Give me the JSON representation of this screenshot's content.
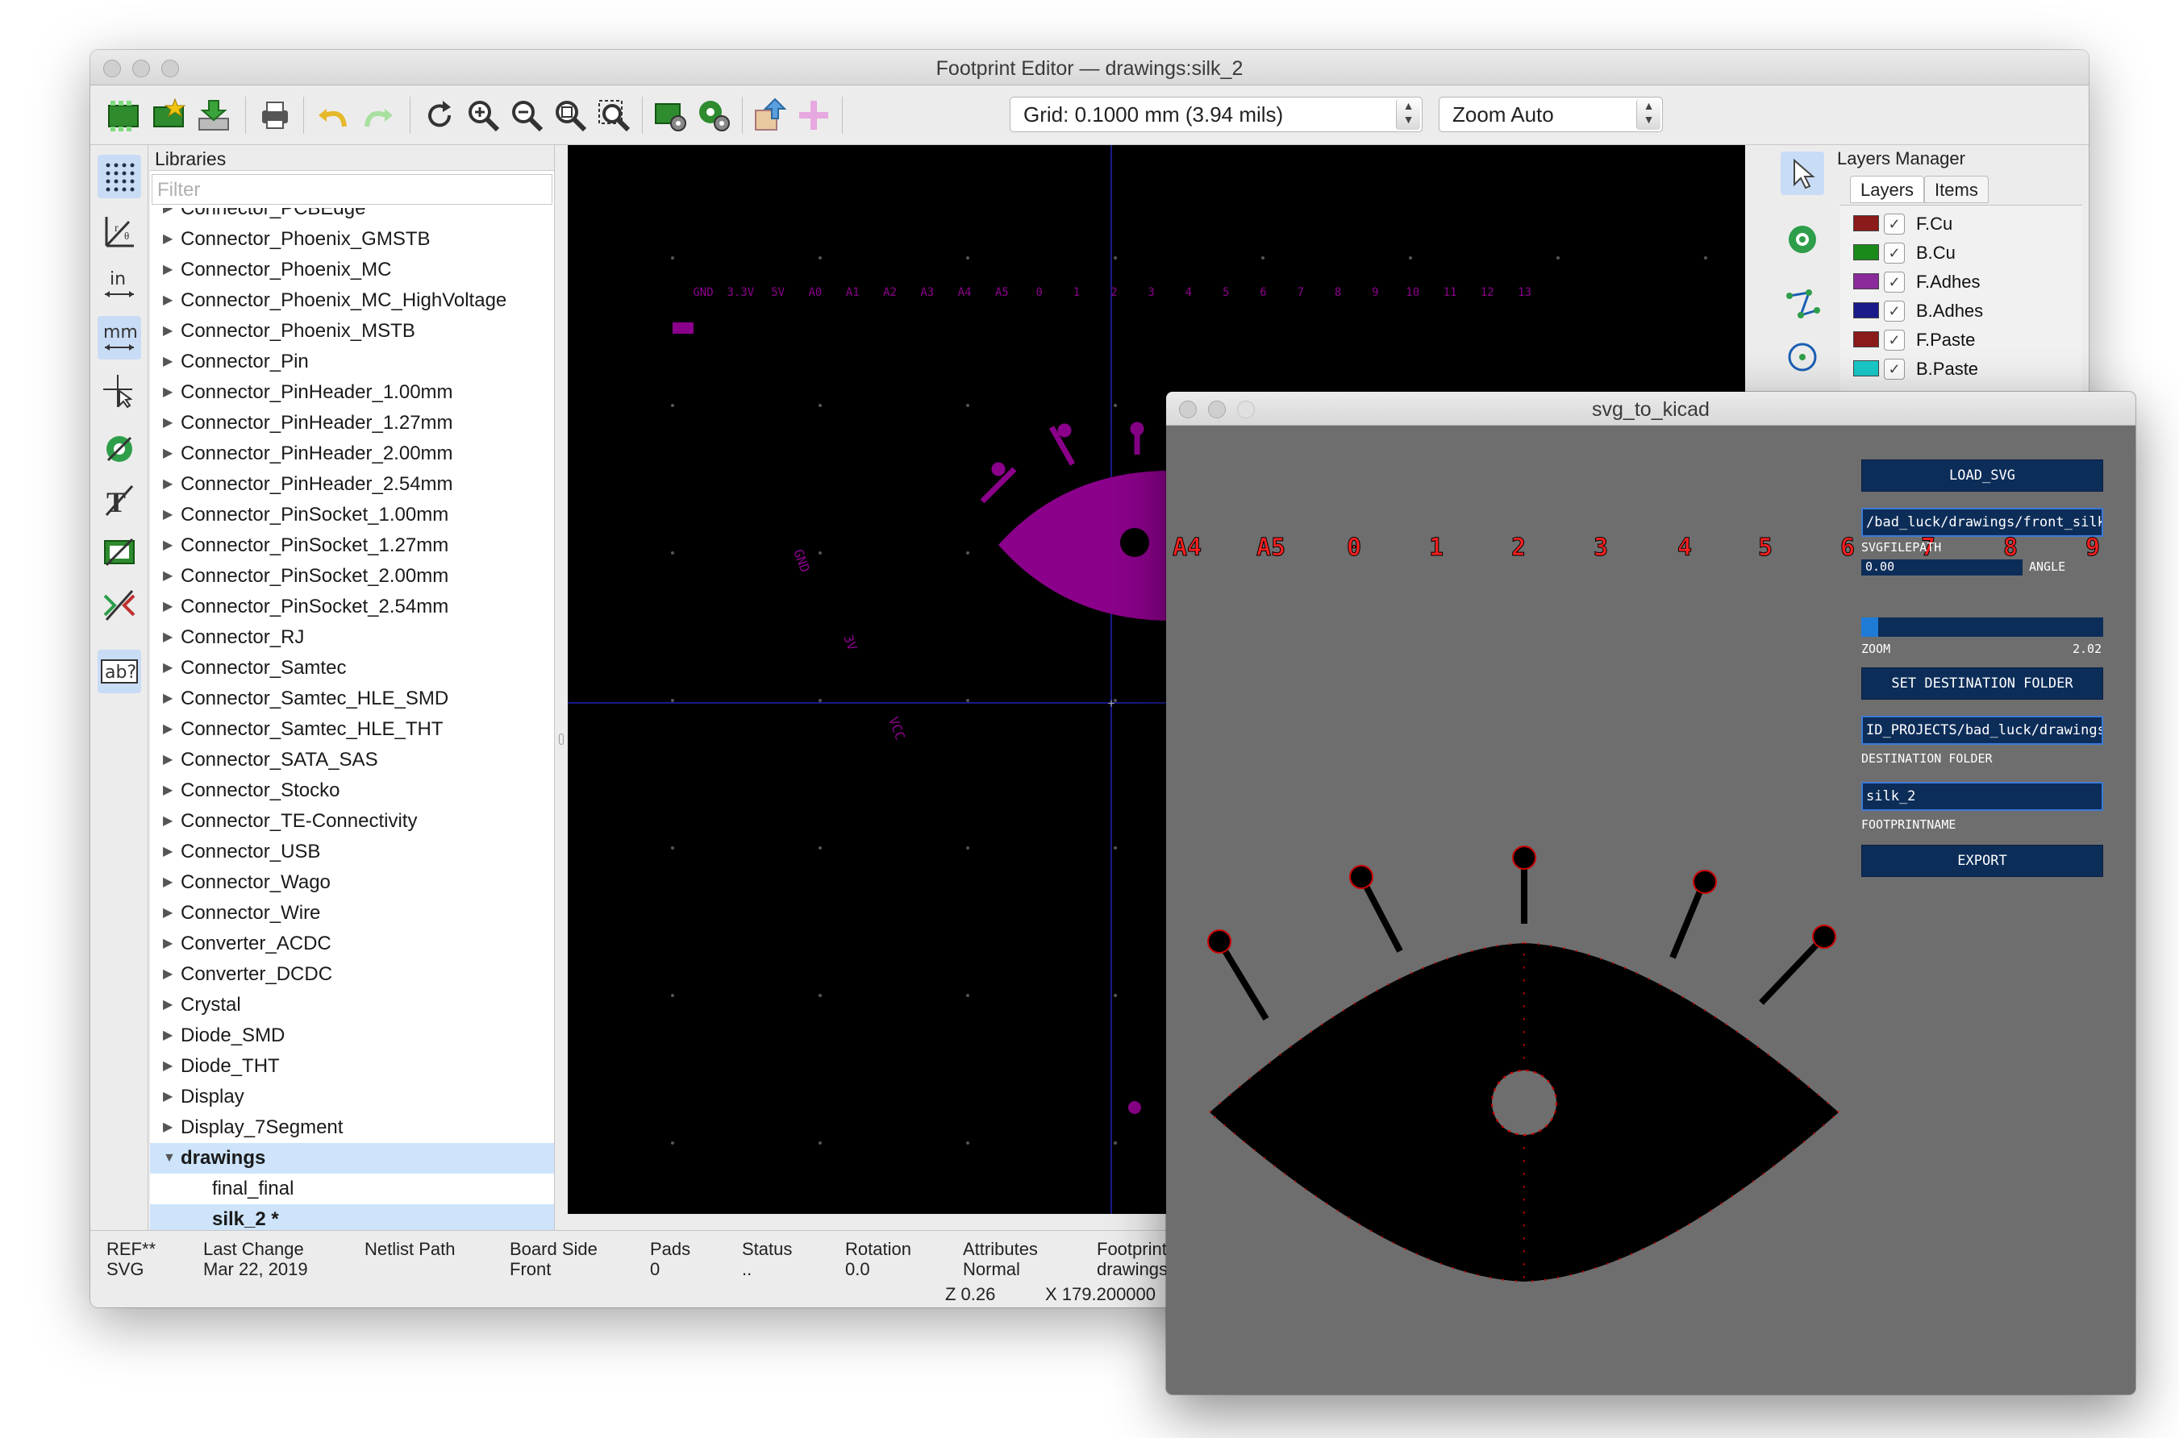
{
  "main_window": {
    "title": "Footprint Editor — drawings:silk_2",
    "grid_select": "Grid: 0.1000 mm (3.94 mils)",
    "zoom_select": "Zoom Auto",
    "toolbar_icons": [
      "new-footprint-icon",
      "new-footprint-wizard-icon",
      "import-footprint-icon",
      "print-icon",
      "undo-icon",
      "redo-icon",
      "refresh-icon",
      "zoom-in-icon",
      "zoom-out-icon",
      "zoom-fit-icon",
      "zoom-selection-icon",
      "footprint-properties-icon",
      "pad-settings-icon",
      "load-from-board-icon",
      "insert-to-board-icon"
    ],
    "left_tools": {
      "units_in": "in",
      "units_mm": "mm",
      "text_tool": "ab?"
    }
  },
  "libraries": {
    "header": "Libraries",
    "filter_placeholder": "Filter",
    "items": [
      "Connector_PCBEdge",
      "Connector_Phoenix_GMSTB",
      "Connector_Phoenix_MC",
      "Connector_Phoenix_MC_HighVoltage",
      "Connector_Phoenix_MSTB",
      "Connector_Pin",
      "Connector_PinHeader_1.00mm",
      "Connector_PinHeader_1.27mm",
      "Connector_PinHeader_2.00mm",
      "Connector_PinHeader_2.54mm",
      "Connector_PinSocket_1.00mm",
      "Connector_PinSocket_1.27mm",
      "Connector_PinSocket_2.00mm",
      "Connector_PinSocket_2.54mm",
      "Connector_RJ",
      "Connector_Samtec",
      "Connector_Samtec_HLE_SMD",
      "Connector_Samtec_HLE_THT",
      "Connector_SATA_SAS",
      "Connector_Stocko",
      "Connector_TE-Connectivity",
      "Connector_USB",
      "Connector_Wago",
      "Connector_Wire",
      "Converter_ACDC",
      "Converter_DCDC",
      "Crystal",
      "Diode_SMD",
      "Diode_THT",
      "Display",
      "Display_7Segment",
      "drawings"
    ],
    "children": [
      "final_final",
      "silk_2 *"
    ]
  },
  "canvas": {
    "pin_labels": [
      "GND",
      "3.3V",
      "5V",
      "A0",
      "A1",
      "A2",
      "A3",
      "A4",
      "A5",
      "0",
      "1",
      "2",
      "3",
      "4",
      "5",
      "6",
      "7",
      "8",
      "9",
      "10",
      "11",
      "12",
      "13"
    ],
    "rotated_labels": [
      "GND",
      "3V",
      "VCC"
    ],
    "colors": {
      "background": "#000000",
      "silk": "#8b008b",
      "axis": "#1a1a8a",
      "grid_dot": "#555555"
    }
  },
  "layers_manager": {
    "title": "Layers Manager",
    "tabs": [
      "Layers",
      "Items"
    ],
    "layers": [
      {
        "name": "F.Cu",
        "color": "#8b1a1a"
      },
      {
        "name": "B.Cu",
        "color": "#1a8b1a"
      },
      {
        "name": "F.Adhes",
        "color": "#8b2a9b"
      },
      {
        "name": "B.Adhes",
        "color": "#1a1a8b"
      },
      {
        "name": "F.Paste",
        "color": "#8b1a1a"
      },
      {
        "name": "B.Paste",
        "color": "#1ac8c8"
      }
    ],
    "check": "✓"
  },
  "status_bar": {
    "cols": [
      {
        "label": "REF**",
        "value": "SVG"
      },
      {
        "label": "Last Change",
        "value": "Mar 22, 2019"
      },
      {
        "label": "Netlist Path",
        "value": ""
      },
      {
        "label": "Board Side",
        "value": "Front"
      },
      {
        "label": "Pads",
        "value": "0"
      },
      {
        "label": "Status",
        "value": ".."
      },
      {
        "label": "Rotation",
        "value": "0.0"
      },
      {
        "label": "Attributes",
        "value": "Normal"
      },
      {
        "label": "Footprint",
        "value": "drawings"
      }
    ],
    "zoom": "Z 0.26",
    "x_coord": "X 179.200000"
  },
  "svg_to_kicad": {
    "title": "svg_to_kicad",
    "load_svg": "LOAD_SVG",
    "svg_filepath": "/bad_luck/drawings/front_silk.svg",
    "svg_filepath_label": "SVGFILEPATH",
    "angle_value": "0.00",
    "angle_label": "ANGLE",
    "zoom_label": "ZOOM",
    "zoom_value": "2.02",
    "zoom_fraction": 0.07,
    "set_dest": "SET DESTINATION FOLDER",
    "dest_folder": "ID_PROJECTS/bad_luck/drawings",
    "dest_label": "DESTINATION FOLDER",
    "footprint_name": "silk_2",
    "footprint_label": "FOOTPRINTNAME",
    "export": "EXPORT",
    "header_labels": [
      "A4",
      "A5",
      "0",
      "1",
      "2",
      "3",
      "4",
      "5",
      "6",
      "7",
      "8",
      "9"
    ]
  }
}
